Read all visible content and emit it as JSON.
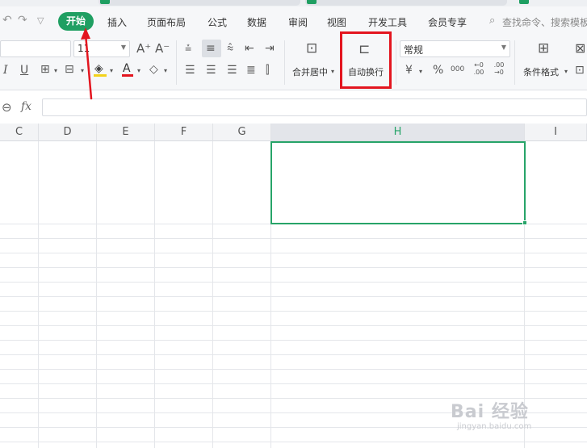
{
  "menu": {
    "start": "开始",
    "tabs": [
      "插入",
      "页面布局",
      "公式",
      "数据",
      "审阅",
      "视图",
      "开发工具",
      "会员专享"
    ],
    "search_placeholder": "查找命令、搜索模板"
  },
  "ribbon": {
    "font_size": "11",
    "number_format": "常规",
    "merge_center_label": "合并居中",
    "wrap_text_label": "自动换行",
    "conditional_format_label": "条件格式",
    "font_grow": "A⁺",
    "font_shrink": "A⁻",
    "italic": "I",
    "underline": "U",
    "currency": "¥",
    "percent": "%",
    "thousands": "000",
    "dec_increase": "←0 .00",
    "dec_decrease": ".00 →0"
  },
  "formula_bar": {
    "fx_label": "fx",
    "value": ""
  },
  "grid": {
    "columns": [
      "C",
      "D",
      "E",
      "F",
      "G",
      "H",
      "I"
    ],
    "selected_column": "H"
  },
  "annotation": {
    "highlight_color": "#e3151f"
  },
  "watermark": {
    "main": "Bai 经验",
    "sub": "jingyan.baidu.com"
  },
  "colors": {
    "accent_green": "#1f9f62",
    "selection_green": "#27a469"
  }
}
